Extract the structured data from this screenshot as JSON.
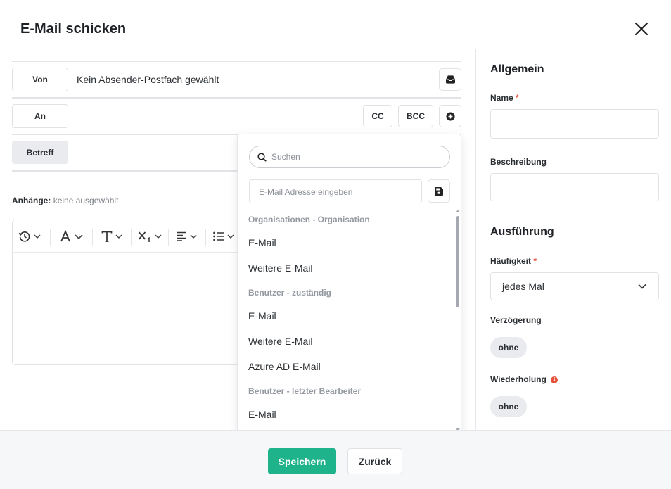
{
  "dialog": {
    "title": "E-Mail schicken"
  },
  "compose": {
    "from_label": "Von",
    "from_value": "Kein Absender-Postfach gewählt",
    "to_label": "An",
    "cc_label": "CC",
    "bcc_label": "BCC",
    "subject_label": "Betreff",
    "attachments_label": "Anhänge:",
    "attachments_value": "keine ausgewählt"
  },
  "dropdown": {
    "search_placeholder": "Suchen",
    "email_placeholder": "E-Mail Adresse eingeben",
    "groups": [
      {
        "label": "Organisationen - Organisation",
        "items": [
          "E-Mail",
          "Weitere E-Mail"
        ]
      },
      {
        "label": "Benutzer - zuständig",
        "items": [
          "E-Mail",
          "Weitere E-Mail",
          "Azure AD E-Mail"
        ]
      },
      {
        "label": "Benutzer - letzter Bearbeiter",
        "items": [
          "E-Mail"
        ]
      }
    ]
  },
  "sidebar": {
    "general_title": "Allgemein",
    "name_label": "Name",
    "required_mark": "*",
    "description_label": "Beschreibung",
    "execution_title": "Ausführung",
    "frequency_label": "Häufigkeit",
    "frequency_value": "jedes Mal",
    "delay_label": "Verzögerung",
    "delay_value": "ohne",
    "repeat_label": "Wiederholung",
    "repeat_info": "i",
    "repeat_value": "ohne"
  },
  "footer": {
    "save_label": "Speichern",
    "back_label": "Zurück"
  },
  "colors": {
    "primary": "#1fb38b",
    "required": "#e5533d"
  },
  "icons": [
    "close-icon",
    "inbox-icon",
    "plus-circle-icon",
    "search-icon",
    "save-icon",
    "history-icon",
    "font-color-icon",
    "text-size-icon",
    "subscript-icon",
    "align-left-icon",
    "list-icon",
    "chevron-down-icon",
    "info-icon"
  ]
}
